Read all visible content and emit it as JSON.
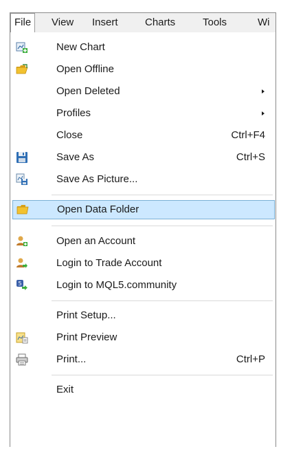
{
  "menubar": {
    "items": [
      "File",
      "View",
      "Insert",
      "Charts",
      "Tools",
      "Wi"
    ]
  },
  "file_menu": {
    "new_chart": {
      "label": "New Chart",
      "icon": "new-chart-icon"
    },
    "open_offline": {
      "label": "Open Offline",
      "icon": "open-folder-icon"
    },
    "open_deleted": {
      "label": "Open Deleted",
      "has_submenu": true
    },
    "profiles": {
      "label": "Profiles",
      "has_submenu": true
    },
    "close": {
      "label": "Close",
      "shortcut": "Ctrl+F4"
    },
    "save_as": {
      "label": "Save As",
      "shortcut": "Ctrl+S",
      "icon": "floppy-disk-icon"
    },
    "save_as_picture": {
      "label": "Save As Picture...",
      "icon": "picture-save-icon"
    },
    "open_data_folder": {
      "label": "Open Data Folder",
      "icon": "folder-icon",
      "highlighted": true
    },
    "open_account": {
      "label": "Open an Account",
      "icon": "user-add-icon"
    },
    "login_trade": {
      "label": "Login to Trade Account",
      "icon": "user-login-icon"
    },
    "login_mql5": {
      "label": "Login to MQL5.community",
      "icon": "mql5-login-icon"
    },
    "print_setup": {
      "label": "Print Setup..."
    },
    "print_preview": {
      "label": "Print Preview",
      "icon": "print-preview-icon"
    },
    "print": {
      "label": "Print...",
      "shortcut": "Ctrl+P",
      "icon": "printer-icon"
    },
    "exit": {
      "label": "Exit"
    }
  },
  "colors": {
    "highlight_bg": "#cce8ff",
    "highlight_border": "#7ab0d6",
    "menubar_bg": "#f0f0f0"
  }
}
